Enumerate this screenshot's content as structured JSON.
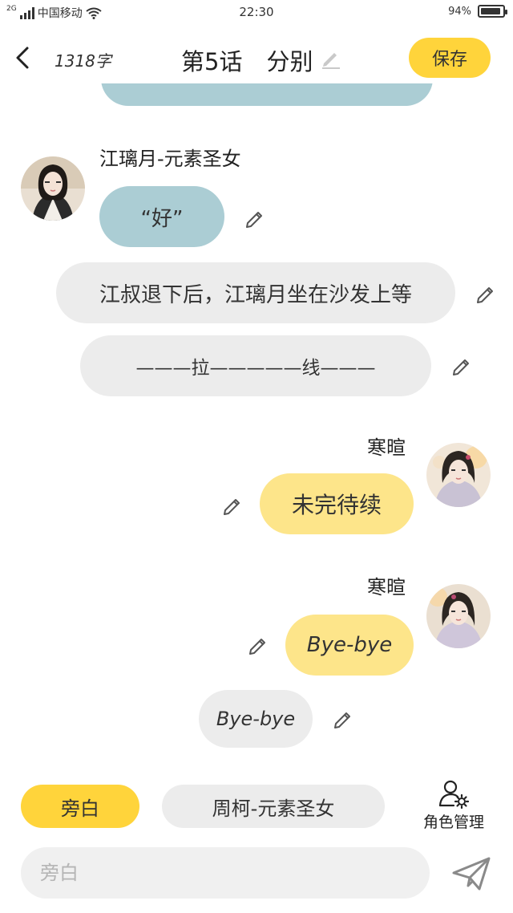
{
  "status_bar": {
    "network": "2G",
    "carrier": "中国移动",
    "time": "22:30",
    "battery": "94%",
    "battery_level": 0.94
  },
  "nav": {
    "word_count": "1318字",
    "episode": "第5话",
    "title": "分别",
    "save_label": "保存"
  },
  "messages": [
    {
      "speaker": "江璃月-元素圣女",
      "text": "“好”",
      "style": "blue",
      "side": "left"
    },
    {
      "text": "江叔退下后，江璃月坐在沙发上等",
      "style": "grey",
      "side": "center"
    },
    {
      "text": "———拉—————线———",
      "style": "grey",
      "side": "center"
    },
    {
      "speaker": "寒暄",
      "text": "未完待续",
      "style": "yellow",
      "side": "right"
    },
    {
      "speaker": "寒暄",
      "text": "Bye-bye",
      "style": "yellow",
      "side": "right"
    },
    {
      "text": "Bye-bye",
      "style": "grey",
      "side": "center"
    }
  ],
  "role_bar": {
    "active_role": "旁白",
    "other_role": "周柯-元素圣女",
    "manage_label": "角色管理"
  },
  "input": {
    "placeholder": "旁白",
    "value": ""
  },
  "colors": {
    "accent_yellow": "#ffd43b",
    "bubble_yellow": "#fde58a",
    "bubble_blue": "#abcdd4",
    "bubble_grey": "#ececec"
  }
}
